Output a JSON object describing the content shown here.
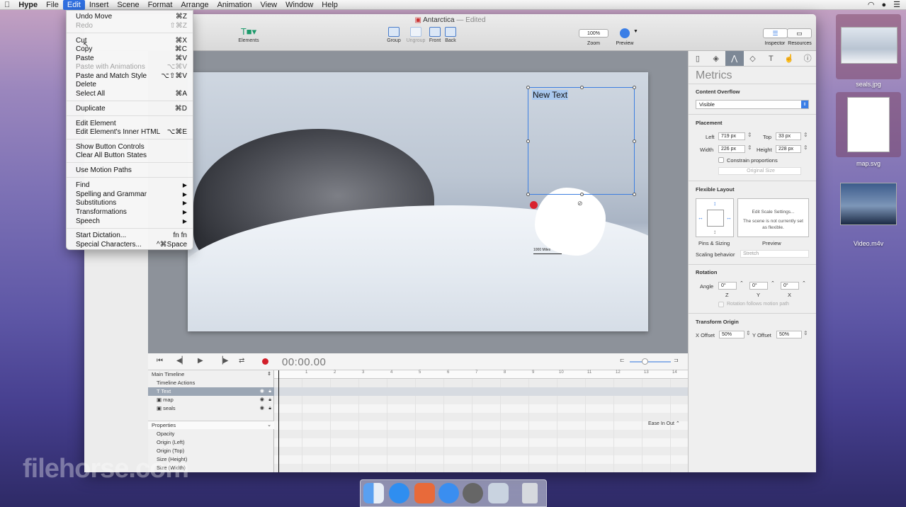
{
  "menubar": {
    "apple": "",
    "app": "Hype",
    "items": [
      "File",
      "Edit",
      "Insert",
      "Scene",
      "Format",
      "Arrange",
      "Animation",
      "View",
      "Window",
      "Help"
    ]
  },
  "window": {
    "title": "Antarctica",
    "edited": "— Edited"
  },
  "toolbar": {
    "elements": "Elements",
    "group": "Group",
    "ungroup": "Ungroup",
    "front": "Front",
    "back": "Back",
    "zoom_value": "100%",
    "zoom": "Zoom",
    "preview": "Preview",
    "inspector": "Inspector",
    "resources": "Resources"
  },
  "stage": {
    "new_text": "New Text",
    "scale_label": "1000 Miles"
  },
  "edit_menu": {
    "undo": {
      "label": "Undo Move",
      "sc": "⌘Z"
    },
    "redo": {
      "label": "Redo",
      "sc": "⇧⌘Z"
    },
    "cut": {
      "label": "Cut",
      "sc": "⌘X"
    },
    "copy": {
      "label": "Copy",
      "sc": "⌘C"
    },
    "paste": {
      "label": "Paste",
      "sc": "⌘V"
    },
    "paste_anim": {
      "label": "Paste with Animations",
      "sc": "⌥⌘V"
    },
    "paste_match": {
      "label": "Paste and Match Style",
      "sc": "⌥⇧⌘V"
    },
    "delete": {
      "label": "Delete"
    },
    "select_all": {
      "label": "Select All",
      "sc": "⌘A"
    },
    "duplicate": {
      "label": "Duplicate",
      "sc": "⌘D"
    },
    "edit_element": {
      "label": "Edit Element"
    },
    "edit_inner": {
      "label": "Edit Element's Inner HTML",
      "sc": "⌥⌘E"
    },
    "show_controls": {
      "label": "Show Button Controls"
    },
    "clear_states": {
      "label": "Clear All Button States"
    },
    "motion_paths": {
      "label": "Use Motion Paths"
    },
    "find": {
      "label": "Find"
    },
    "spelling": {
      "label": "Spelling and Grammar"
    },
    "substitutions": {
      "label": "Substitutions"
    },
    "transformations": {
      "label": "Transformations"
    },
    "speech": {
      "label": "Speech"
    },
    "dictation": {
      "label": "Start Dictation...",
      "sc": "fn fn"
    },
    "special": {
      "label": "Special Characters...",
      "sc": "^⌘Space"
    }
  },
  "timeline": {
    "timecode": "00:00.00",
    "main": "Main Timeline",
    "actions": "Timeline Actions",
    "layers": [
      "Text",
      "map",
      "seals"
    ],
    "properties": "Properties",
    "props": [
      "Opacity",
      "Origin (Left)",
      "Origin (Top)",
      "Size (Height)",
      "Size (Width)"
    ],
    "ease": "Ease In Out",
    "ruler": [
      "1",
      "2",
      "3",
      "4",
      "5",
      "6",
      "7",
      "8",
      "9",
      "10",
      "11",
      "12",
      "13",
      "14"
    ]
  },
  "inspector": {
    "title": "Metrics",
    "overflow_h": "Content Overflow",
    "overflow_val": "Visible",
    "placement_h": "Placement",
    "left_l": "Left",
    "left_v": "719 px",
    "top_l": "Top",
    "top_v": "33 px",
    "width_l": "Width",
    "width_v": "226 px",
    "height_l": "Height",
    "height_v": "228 px",
    "constrain": "Constrain proportions",
    "original": "Original Size",
    "flex_h": "Flexible Layout",
    "scale_settings": "Edit Scale Settings...",
    "scale_note": "The scene is not currently set as flexible.",
    "pins": "Pins & Sizing",
    "preview": "Preview",
    "scaling_l": "Scaling behavior",
    "scaling_v": "Stretch",
    "rotation_h": "Rotation",
    "angle": "Angle",
    "z": "0°",
    "y": "0°",
    "x": "0°",
    "zl": "Z",
    "yl": "Y",
    "xl": "X",
    "rot_follow": "Rotation follows motion path",
    "origin_h": "Transform Origin",
    "xoff_l": "X Offset",
    "xoff_v": "50%",
    "yoff_l": "Y Offset",
    "yoff_v": "50%"
  },
  "desktop": {
    "files": [
      "seals.jpg",
      "map.svg",
      "Video.m4v"
    ]
  },
  "watermark": "filehorse.com"
}
